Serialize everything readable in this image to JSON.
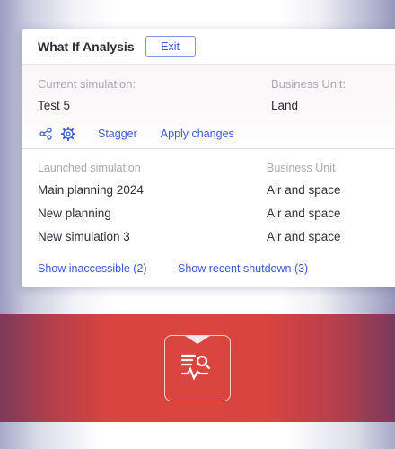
{
  "panel": {
    "title": "What If Analysis",
    "exit_label": "Exit"
  },
  "current": {
    "simulation_label": "Current simulation:",
    "simulation_value": "Test 5",
    "business_unit_label": "Business Unit:",
    "business_unit_value": "Land",
    "actions": {
      "share_icon": "share-icon",
      "settings_icon": "gear-icon",
      "stagger_label": "Stagger",
      "apply_label": "Apply changes"
    }
  },
  "launched": {
    "col_simulation": "Launched simulation",
    "col_business_unit": "Business Unit",
    "rows": [
      {
        "name": "Main planning 2024",
        "unit": "Air and space"
      },
      {
        "name": "New planning",
        "unit": "Air and space"
      },
      {
        "name": "New simulation 3",
        "unit": "Air and space"
      }
    ],
    "show_inaccessible": "Show inaccessible (2)",
    "show_recent_shutdown": "Show recent shutdown (3)"
  },
  "colors": {
    "accent": "#3d5bd6",
    "band_red": "#d8443f",
    "text_primary": "#2f2f3e",
    "text_muted": "#a9a9b6"
  },
  "app_icon": "analysis-search-icon"
}
